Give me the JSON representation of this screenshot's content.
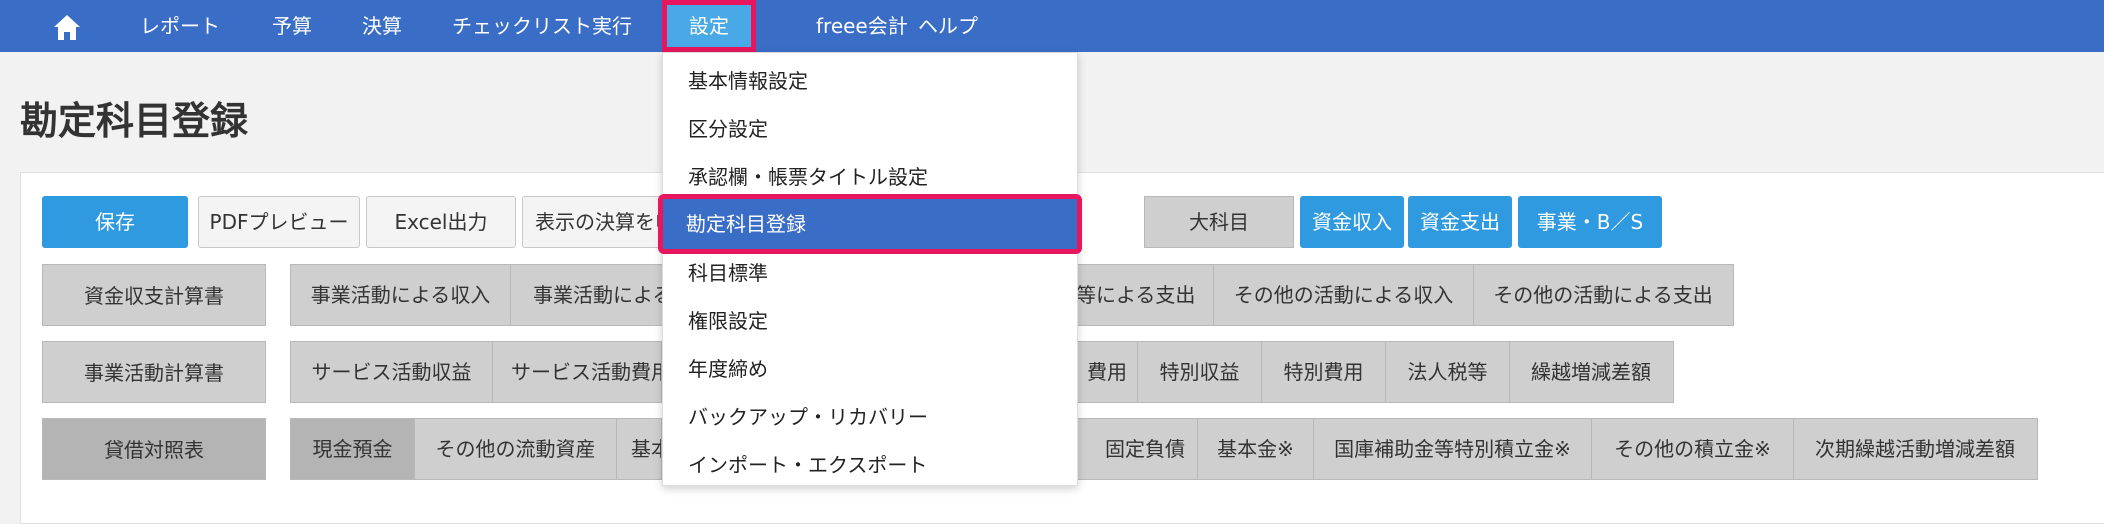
{
  "nav": {
    "home_icon": "home-icon",
    "items": [
      "レポート",
      "予算",
      "決算",
      "チェックリスト実行",
      "設定",
      "freee会計",
      "ヘルプ"
    ]
  },
  "page_title": "勘定科目登録",
  "toolbar": {
    "save": "保存",
    "pdf_preview": "PDFプレビュー",
    "excel_export": "Excel出力",
    "show_settlement": "表示の決算を申",
    "major_category": "大科目",
    "fund_income": "資金収入",
    "fund_expense": "資金支出",
    "business_bs": "事業・B／S"
  },
  "rows": [
    {
      "label": "資金収支計算書",
      "items": [
        "事業活動による収入",
        "事業活動による",
        "等による支出",
        "その他の活動による収入",
        "その他の活動による支出"
      ]
    },
    {
      "label": "事業活動計算書",
      "items": [
        "サービス活動収益",
        "サービス活動費用",
        "費用",
        "特別収益",
        "特別費用",
        "法人税等",
        "繰越増減差額"
      ]
    },
    {
      "label": "貸借対照表",
      "items": [
        "現金預金",
        "その他の流動資産",
        "基本",
        "固定負債",
        "基本金※",
        "国庫補助金等特別積立金※",
        "その他の積立金※",
        "次期繰越活動増減差額"
      ]
    }
  ],
  "dropdown": {
    "items": [
      "基本情報設定",
      "区分設定",
      "承認欄・帳票タイトル設定",
      "勘定科目登録",
      "科目標準",
      "権限設定",
      "年度締め",
      "バックアップ・リカバリー",
      "インポート・エクスポート"
    ]
  },
  "colors": {
    "nav": "#3a6dc5",
    "active_tab": "#49a8e6",
    "highlight": "#e8175d",
    "primary": "#2f9ae0"
  }
}
